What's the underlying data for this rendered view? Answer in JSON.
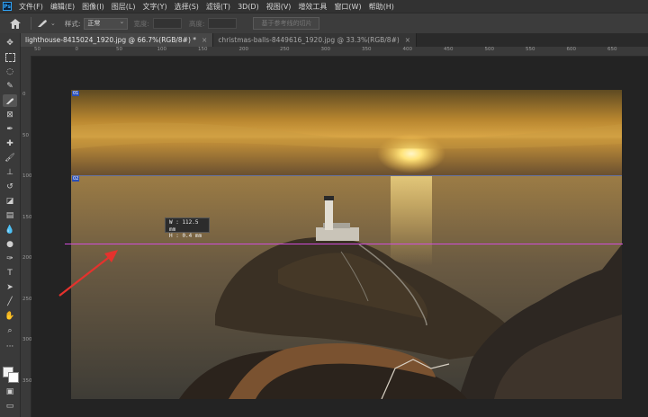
{
  "app": {
    "logo_text": "Ps"
  },
  "menubar": {
    "items": [
      "文件(F)",
      "编辑(E)",
      "图像(I)",
      "图层(L)",
      "文字(Y)",
      "选择(S)",
      "滤镜(T)",
      "3D(D)",
      "视图(V)",
      "增效工具",
      "窗口(W)",
      "帮助(H)"
    ]
  },
  "options": {
    "style_label": "样式:",
    "style_value": "正常",
    "width_label": "宽度:",
    "height_label": "高度:",
    "slice_button": "基于参考线的切片"
  },
  "tabs": [
    {
      "label": "lighthouse-8415024_1920.jpg @ 66.7%(RGB/8#) *",
      "close": "×"
    },
    {
      "label": "christmas-balls-8449616_1920.jpg @ 33.3%(RGB/8#)",
      "close": "×"
    }
  ],
  "ruler": {
    "h_labels": [
      "50",
      "0",
      "50",
      "100",
      "150",
      "200",
      "250",
      "300",
      "350",
      "400",
      "450",
      "500",
      "550",
      "600",
      "650",
      "700"
    ],
    "v_labels": [
      "0",
      "50",
      "100",
      "150",
      "200",
      "250",
      "300",
      "350"
    ]
  },
  "slices": {
    "top_label": "01",
    "mid_label": "02"
  },
  "measure": {
    "w": "W : 112.5 mm",
    "h": "H :    0.4 mm"
  },
  "colors": {
    "accent": "#31a8ff",
    "guide": "#d04dd9",
    "arrow": "#e5322d"
  }
}
